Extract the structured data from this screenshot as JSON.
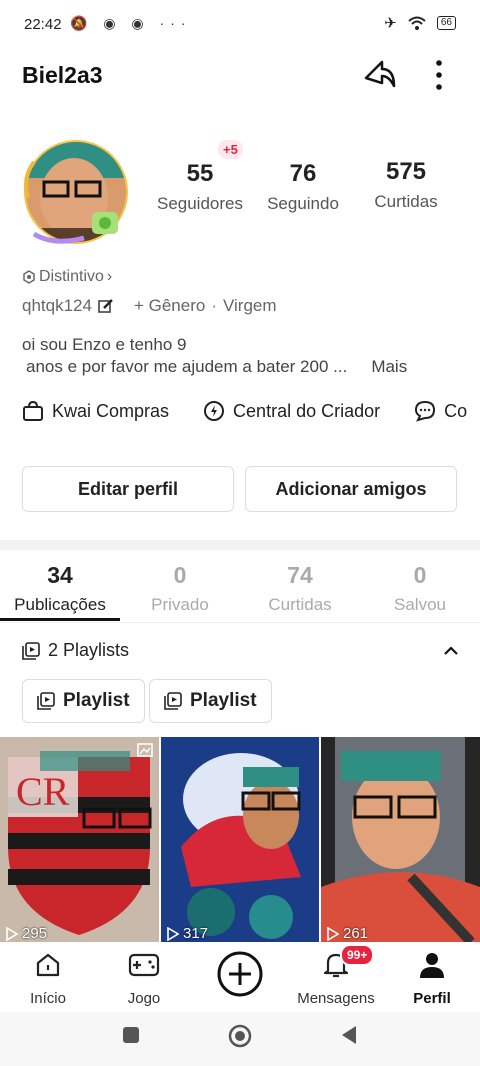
{
  "status_bar": {
    "time": "22:42",
    "left_icons": "🔕 ◉ ◉  ···",
    "battery": "66"
  },
  "header": {
    "username": "Biel2a3"
  },
  "profile": {
    "new_followers_badge": "+5",
    "stats": [
      {
        "value": "55",
        "label": "Seguidores"
      },
      {
        "value": "76",
        "label": "Seguindo"
      },
      {
        "value": "575",
        "label": "Curtidas"
      }
    ],
    "distintivo": "Distintivo",
    "handle": "qhtqk124",
    "gender": "+ Gênero",
    "separator": "·",
    "sign": "Virgem",
    "bio_line1": "oi sou Enzo e tenho 9",
    "bio_line2": "anos e por favor me ajudem a bater 200  ...",
    "bio_more": "Mais"
  },
  "shortcuts": [
    {
      "label": "Kwai Compras",
      "icon": "shopping-bag-icon"
    },
    {
      "label": "Central do Criador",
      "icon": "bolt-circle-icon"
    },
    {
      "label": "Co",
      "icon": "chat-bubble-icon"
    }
  ],
  "buttons": {
    "edit": "Editar perfil",
    "add_friends": "Adicionar amigos"
  },
  "tabs": [
    {
      "count": "34",
      "label": "Publicações",
      "active": true
    },
    {
      "count": "0",
      "label": "Privado"
    },
    {
      "count": "74",
      "label": "Curtidas"
    },
    {
      "count": "0",
      "label": "Salvou"
    }
  ],
  "playlists": {
    "header": "2 Playlists",
    "items": [
      "Playlist",
      "Playlist"
    ]
  },
  "videos": [
    {
      "views": "295"
    },
    {
      "views": "317"
    },
    {
      "views": "261"
    }
  ],
  "bottom_nav": {
    "items": [
      "Início",
      "Jogo",
      "Mensagens",
      "Perfil"
    ],
    "message_badge": "99+"
  },
  "colors": {
    "accent": "#e8233f",
    "text": "#222222",
    "muted": "#aaaaaa"
  }
}
